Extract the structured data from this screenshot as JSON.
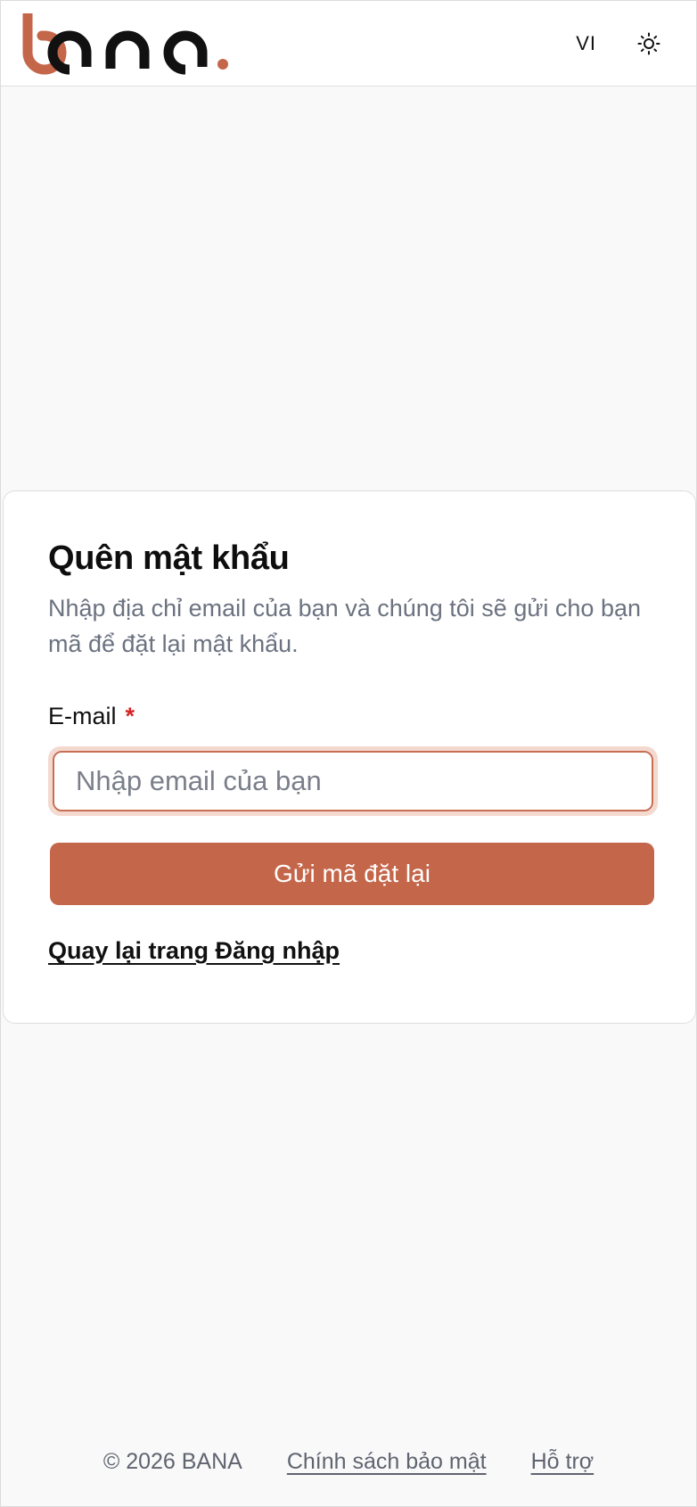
{
  "brand": {
    "logo_text": "bana",
    "colors": {
      "accent": "#c4664a",
      "dark": "#111111"
    }
  },
  "header": {
    "language_label": "VI",
    "theme_icon": "sun-icon"
  },
  "form": {
    "title": "Quên mật khẩu",
    "description": "Nhập địa chỉ email của bạn và chúng tôi sẽ gửi cho bạn mã để đặt lại mật khẩu.",
    "email_label": "E-mail",
    "required_mark": "*",
    "email_value": "",
    "email_placeholder": "Nhập email của bạn",
    "submit_label": "Gửi mã đặt lại",
    "back_link_label": "Quay lại trang Đăng nhập"
  },
  "footer": {
    "copyright": "© 2026 BANA",
    "privacy_label": "Chính sách bảo mật",
    "support_label": "Hỗ trợ"
  }
}
